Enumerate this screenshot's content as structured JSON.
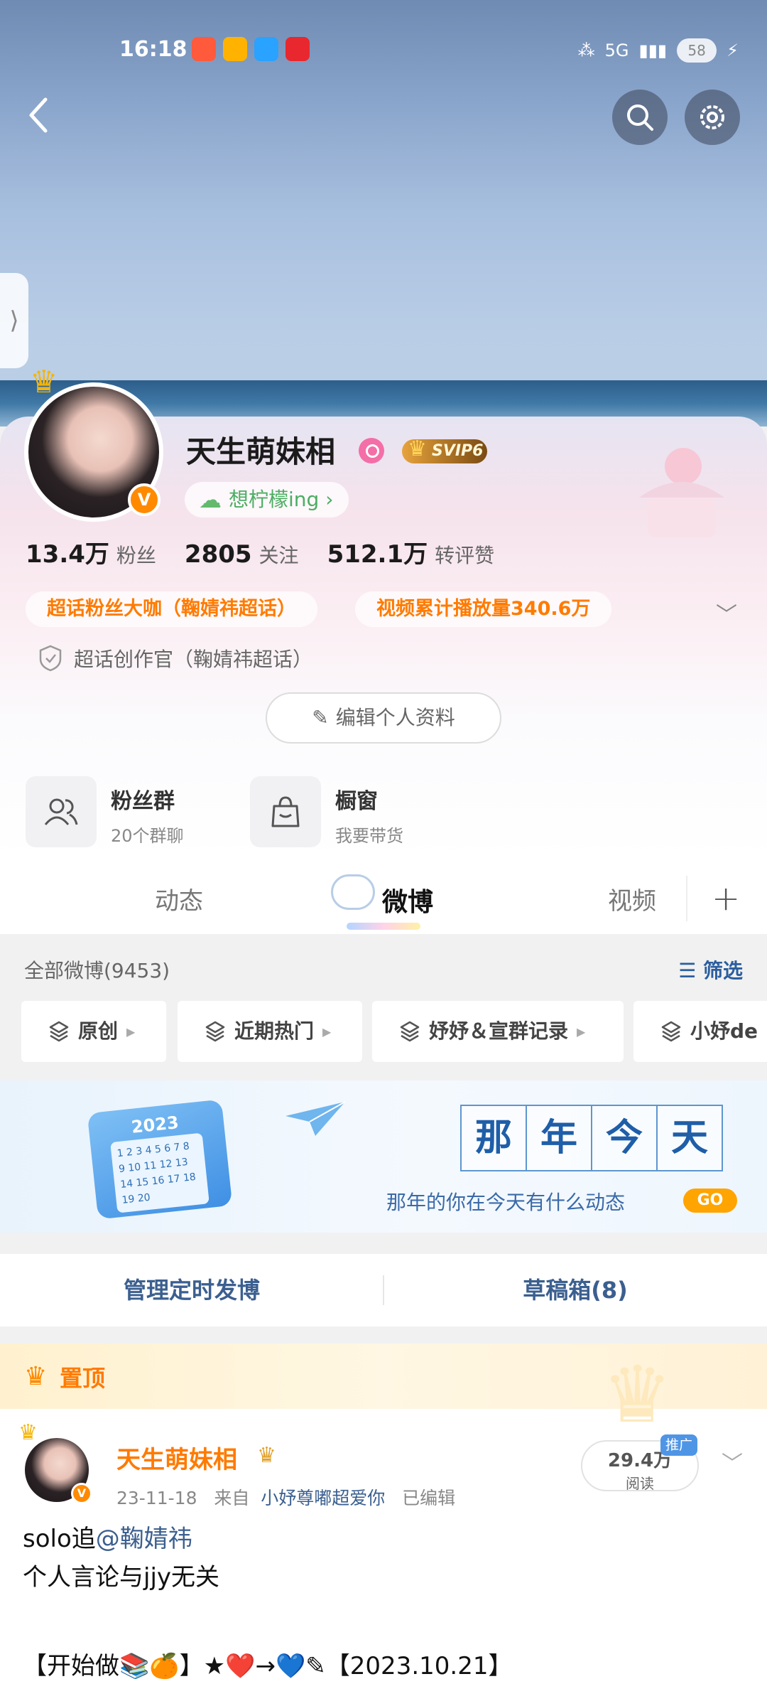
{
  "status_bar": {
    "time": "16:18",
    "battery": "58",
    "network": "5G"
  },
  "profile": {
    "nickname": "天生萌妹相",
    "vip_badge": "SVIP6",
    "mood": "想柠檬ing",
    "mood_arrow": "›",
    "verified_mark": "V",
    "stats": [
      {
        "value": "13.4万",
        "label": "粉丝"
      },
      {
        "value": "2805",
        "label": "关注"
      },
      {
        "value": "512.1万",
        "label": "转评赞"
      }
    ],
    "tags": [
      "超话粉丝大咖（鞠婧祎超话）",
      "视频累计播放量340.6万"
    ],
    "certification": "超话创作官（鞠婧祎超话）",
    "edit_button": "编辑个人资料",
    "features": [
      {
        "title": "粉丝群",
        "subtitle": "20个群聊",
        "icon": "people-icon"
      },
      {
        "title": "橱窗",
        "subtitle": "我要带货",
        "icon": "shopping-bag-icon"
      }
    ]
  },
  "tabs": [
    {
      "label": "动态",
      "active": false
    },
    {
      "label": "微博",
      "active": true
    },
    {
      "label": "视频",
      "active": false
    }
  ],
  "filter": {
    "all_weibo": "全部微博(9453)",
    "screen_label": "筛选",
    "chips": [
      "原创",
      "近期热门",
      "妤妤＆宣群记录",
      "小妤de"
    ]
  },
  "memory": {
    "title_chars": [
      "那",
      "年",
      "今",
      "天"
    ],
    "subtitle": "那年的你在今天有什么动态",
    "go": "GO",
    "calendar_year": "2023",
    "calendar_numbers": "1 2 3 4 5 6 7 8 9 10 11 12 13 14 15 16 17 18 19 20"
  },
  "manage": {
    "scheduled": "管理定时发博",
    "drafts": "草稿箱(8)"
  },
  "post": {
    "pinned_label": "置顶",
    "author": "天生萌妹相",
    "date": "23-11-18",
    "from_prefix": "来自",
    "source": "小妤尊嘟超爱你",
    "edited": "已编辑",
    "reads": "29.4万",
    "reads_label": "阅读",
    "promo": "推广",
    "text_line1_prefix": "solo追",
    "mention": "@鞠婧祎",
    "text_line2": "个人言论与jjy无关",
    "text_line3": "【开始做📚🍊】★❤️→💙✎【2023.10.21】"
  },
  "colors": {
    "accent_orange": "#ff7a00",
    "link_blue": "#3b5f8f",
    "mood_green": "#4cad62"
  }
}
